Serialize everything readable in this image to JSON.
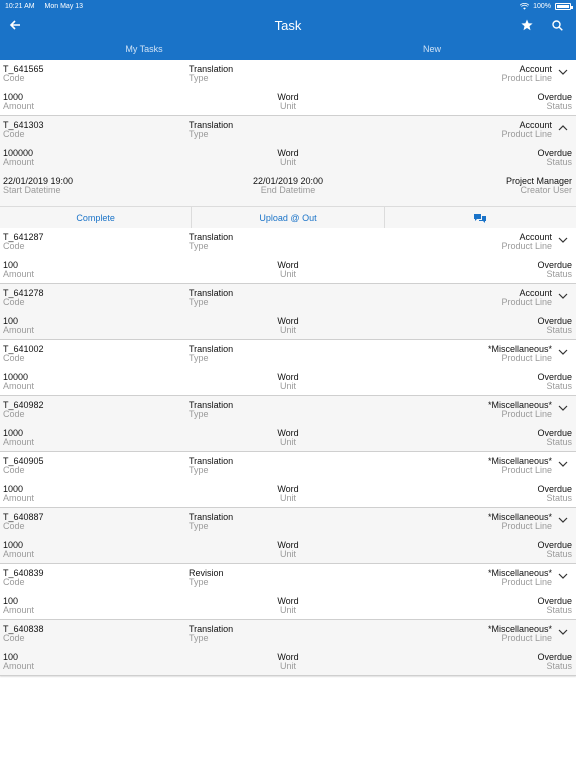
{
  "status_bar": {
    "time": "10:21 AM",
    "date": "Mon May 13",
    "battery": "100%"
  },
  "header": {
    "title": "Task"
  },
  "tabs": [
    {
      "label": "My Tasks"
    },
    {
      "label": "New"
    }
  ],
  "labels": {
    "code": "Code",
    "type": "Type",
    "product_line": "Product Line",
    "amount": "Amount",
    "unit": "Unit",
    "status": "Status",
    "start_datetime": "Start Datetime",
    "end_datetime": "End Datetime",
    "creator_user": "Creator User"
  },
  "tasks": [
    {
      "code": "T_641565",
      "type": "Translation",
      "product_line": "Account",
      "amount": "1000",
      "unit": "Word",
      "status": "Overdue"
    },
    {
      "code": "T_641303",
      "type": "Translation",
      "product_line": "Account",
      "amount": "100000",
      "unit": "Word",
      "status": "Overdue",
      "start": "22/01/2019 19:00",
      "end": "22/01/2019 20:00",
      "creator": "Project Manager"
    },
    {
      "code": "T_641287",
      "type": "Translation",
      "product_line": "Account",
      "amount": "100",
      "unit": "Word",
      "status": "Overdue"
    },
    {
      "code": "T_641278",
      "type": "Translation",
      "product_line": "Account",
      "amount": "100",
      "unit": "Word",
      "status": "Overdue"
    },
    {
      "code": "T_641002",
      "type": "Translation",
      "product_line": "*Miscellaneous*",
      "amount": "10000",
      "unit": "Word",
      "status": "Overdue"
    },
    {
      "code": "T_640982",
      "type": "Translation",
      "product_line": "*Miscellaneous*",
      "amount": "1000",
      "unit": "Word",
      "status": "Overdue"
    },
    {
      "code": "T_640905",
      "type": "Translation",
      "product_line": "*Miscellaneous*",
      "amount": "1000",
      "unit": "Word",
      "status": "Overdue"
    },
    {
      "code": "T_640887",
      "type": "Translation",
      "product_line": "*Miscellaneous*",
      "amount": "1000",
      "unit": "Word",
      "status": "Overdue"
    },
    {
      "code": "T_640839",
      "type": "Revision",
      "product_line": "*Miscellaneous*",
      "amount": "100",
      "unit": "Word",
      "status": "Overdue"
    },
    {
      "code": "T_640838",
      "type": "Translation",
      "product_line": "*Miscellaneous*",
      "amount": "100",
      "unit": "Word",
      "status": "Overdue"
    }
  ],
  "actions": {
    "complete": "Complete",
    "upload": "Upload @ Out",
    "chat_icon": "chat-bubbles-icon"
  },
  "colors": {
    "brand": "#1a73c8",
    "label": "#9a9a9a"
  }
}
